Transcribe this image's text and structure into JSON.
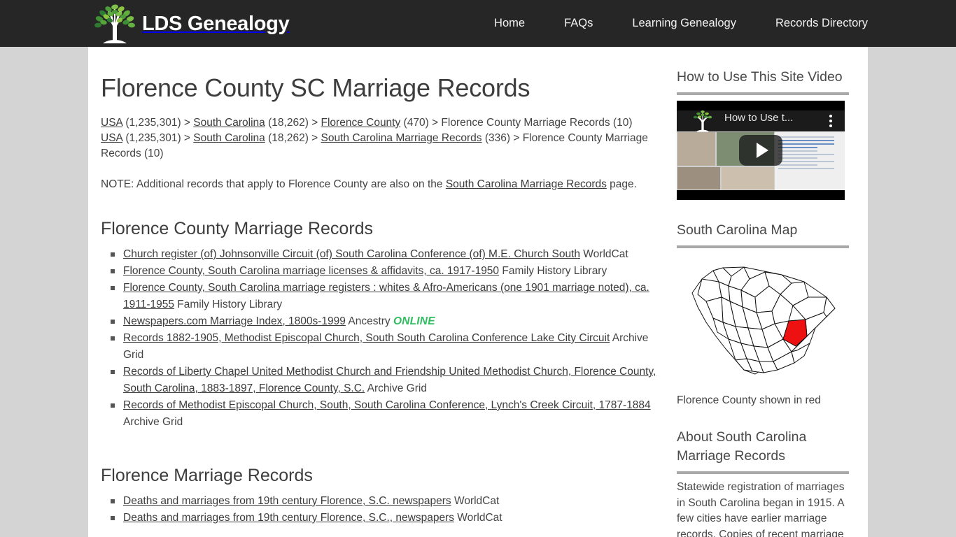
{
  "header": {
    "brand_name": "LDS Genealogy",
    "logo_icon": "family-tree-icon",
    "nav": [
      {
        "label": "Home"
      },
      {
        "label": "FAQs"
      },
      {
        "label": "Learning Genealogy"
      },
      {
        "label": "Records Directory"
      }
    ]
  },
  "main": {
    "title": "Florence County SC Marriage Records",
    "breadcrumb1": {
      "l1": "USA",
      "c1": " (1,235,301) > ",
      "l2": "South Carolina",
      "c2": " (18,262) > ",
      "l3": "Florence County",
      "c3": " (470) > Florence County Marriage Records (10)"
    },
    "breadcrumb2": {
      "l1": "USA",
      "c1": " (1,235,301) > ",
      "l2": "South Carolina",
      "c2": " (18,262) > ",
      "l3": "South Carolina Marriage Records",
      "c3": " (336) > Florence County Marriage Records (10)"
    },
    "note": {
      "before": "NOTE: Additional records that apply to Florence County are also on the ",
      "link": "South Carolina Marriage Records",
      "after": " page."
    },
    "section1_title": "Florence County Marriage Records",
    "section1_items": [
      {
        "link": "Church register (of) Johnsonville Circuit (of) South Carolina Conference (of) M.E. Church South",
        "source": " WorldCat",
        "online": ""
      },
      {
        "link": "Florence County, South Carolina marriage licenses & affidavits, ca. 1917-1950",
        "source": " Family History Library",
        "online": ""
      },
      {
        "link": "Florence County, South Carolina marriage registers : whites & Afro-Americans (one 1901 marriage noted), ca. 1911-1955",
        "source": " Family History Library",
        "online": ""
      },
      {
        "link": "Newspapers.com Marriage Index, 1800s-1999",
        "source": " Ancestry ",
        "online": "ONLINE"
      },
      {
        "link": "Records 1882-1905, Methodist Episcopal Church, South South Carolina Conference Lake City Circuit",
        "source": " Archive Grid",
        "online": ""
      },
      {
        "link": "Records of Liberty Chapel United Methodist Church and Friendship United Methodist Church, Florence County, South Carolina, 1883-1897, Florence County, S.C.",
        "source": " Archive Grid",
        "online": ""
      },
      {
        "link": "Records of Methodist Episcopal Church, South, South Carolina Conference, Lynch's Creek Circuit, 1787-1884",
        "source": " Archive Grid",
        "online": ""
      }
    ],
    "section2_title": "Florence Marriage Records",
    "section2_items": [
      {
        "link": "Deaths and marriages from 19th century Florence, S.C. newspapers",
        "source": " WorldCat",
        "online": ""
      },
      {
        "link": "Deaths and marriages from 19th century Florence, S.C., newspapers",
        "source": " WorldCat",
        "online": ""
      }
    ]
  },
  "sidebar": {
    "video": {
      "heading": "How to Use This Site Video",
      "player_title": "How to Use t...",
      "play_icon": "play-button-icon",
      "menu_icon": "kebab-menu-icon"
    },
    "map": {
      "heading": "South Carolina Map",
      "caption": "Florence County shown in red",
      "highlight_color": "#ee1111"
    },
    "about": {
      "heading": "About South Carolina Marriage Records",
      "text": "Statewide registration of marriages in South Carolina began in 1915. A few cities have earlier marriage records. Copies of recent marriage"
    }
  },
  "colors": {
    "header_bg": "#262626",
    "page_bg": "#d4d4d4",
    "content_bg": "#ffffff",
    "online_green": "#2fbd60",
    "text": "#444444"
  }
}
